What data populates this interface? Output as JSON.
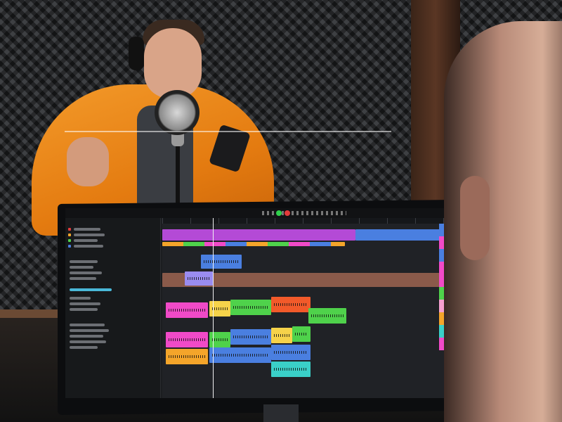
{
  "photo": {
    "description_subjects": [],
    "colors": {
      "jacket": "#e47b10",
      "foam": "#2c2e31",
      "daw_background": "#1b1d20"
    }
  },
  "daw": {
    "clip_colors": [
      "#b44ad6",
      "#4a7fe0",
      "#8a5a4a",
      "#f14ac8",
      "#f6d34a",
      "#4fd24b",
      "#f25a2a",
      "#f4a52a",
      "#3ad0c8",
      "#9a8cf0"
    ]
  }
}
